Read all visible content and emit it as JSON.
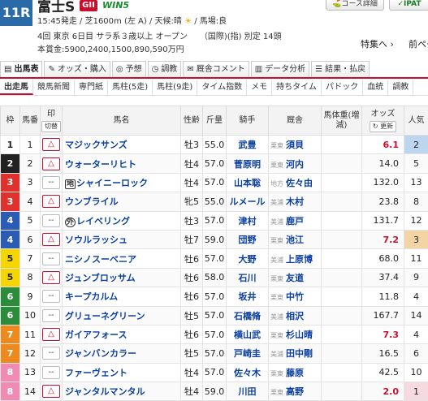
{
  "race": {
    "number": "11R",
    "name": "富士S",
    "grade": "GII",
    "win5": "WIN5",
    "post_time": "15:45発走",
    "distance": "芝1600m (左 A)",
    "weather_label": "天候:晴",
    "weather_icon": "sun-icon",
    "track_condition": "馬場:良",
    "meeting_line": "4回 東京 6日目 サラ系３歳以上 オープン　　（国際)(指) 別定 14頭",
    "prize_line": "本賞金:5900,2400,1500,890,590万円"
  },
  "header_buttons": {
    "course": "コース詳細",
    "ipat": "IPAT",
    "special": "特集へ",
    "next": "前ページ"
  },
  "tabs": [
    {
      "label": "出馬表",
      "icon": "table-icon"
    },
    {
      "label": "オッズ・購入",
      "icon": "odds-icon"
    },
    {
      "label": "予想",
      "icon": "target-icon"
    },
    {
      "label": "調教",
      "icon": "clock-icon"
    },
    {
      "label": "厩舎コメント",
      "icon": "comment-icon"
    },
    {
      "label": "データ分析",
      "icon": "chart-icon"
    },
    {
      "label": "結果・払戻",
      "icon": "result-icon"
    }
  ],
  "subtabs": [
    "出走馬",
    "競馬新聞",
    "専門紙",
    "馬柱(5走)",
    "馬柱(9走)",
    "タイム指数",
    "メモ",
    "持ちタイム",
    "パドック",
    "血統",
    "調教"
  ],
  "columns": {
    "waku": "枠",
    "umaban": "馬番",
    "mark": "印",
    "mark_sub": "切替",
    "horse": "馬名",
    "sex_age": "性齢",
    "weight": "斤量",
    "jockey": "騎手",
    "trainer": "厩舎",
    "body_weight": "馬体重(増減)",
    "odds": "オッズ",
    "odds_update": "更新",
    "popularity": "人気"
  },
  "rows": [
    {
      "waku": "1",
      "num": "1",
      "mark": "△",
      "name": "マジックサンズ",
      "prefix": "",
      "sex_age": "牡3",
      "weight": "55.0",
      "jockey": "武豊",
      "area": "栗東",
      "trainer": "須貝",
      "odds": "6.1",
      "hot": true,
      "pop": "2"
    },
    {
      "waku": "2",
      "num": "2",
      "mark": "△",
      "name": "ウォーターリヒト",
      "prefix": "",
      "sex_age": "牡4",
      "weight": "57.0",
      "jockey": "菅原明",
      "area": "栗東",
      "trainer": "河内",
      "odds": "14.0",
      "hot": false,
      "pop": "5"
    },
    {
      "waku": "3",
      "num": "3",
      "mark": "--",
      "name": "シャイニーロック",
      "prefix": "地",
      "sex_age": "牡4",
      "weight": "57.0",
      "jockey": "山本聡",
      "area": "地方",
      "trainer": "佐々由",
      "odds": "132.0",
      "hot": false,
      "pop": "13"
    },
    {
      "waku": "3",
      "num": "4",
      "mark": "△",
      "name": "ウンブライル",
      "prefix": "",
      "sex_age": "牝5",
      "weight": "55.0",
      "jockey": "ルメール",
      "area": "美浦",
      "trainer": "木村",
      "odds": "23.8",
      "hot": false,
      "pop": "8"
    },
    {
      "waku": "4",
      "num": "5",
      "mark": "--",
      "name": "レイベリング",
      "prefix": "外",
      "sex_age": "牡3",
      "weight": "57.0",
      "jockey": "津村",
      "area": "美浦",
      "trainer": "鹿戸",
      "odds": "131.7",
      "hot": false,
      "pop": "12"
    },
    {
      "waku": "4",
      "num": "6",
      "mark": "△",
      "name": "ソウルラッシュ",
      "prefix": "",
      "sex_age": "牡7",
      "weight": "59.0",
      "jockey": "団野",
      "area": "栗東",
      "trainer": "池江",
      "odds": "7.2",
      "hot": true,
      "pop": "3"
    },
    {
      "waku": "5",
      "num": "7",
      "mark": "--",
      "name": "ニシノスーベニア",
      "prefix": "",
      "sex_age": "牡6",
      "weight": "57.0",
      "jockey": "大野",
      "area": "美浦",
      "trainer": "上原博",
      "odds": "68.0",
      "hot": false,
      "pop": "11"
    },
    {
      "waku": "5",
      "num": "8",
      "mark": "△",
      "name": "ジュンブロッサム",
      "prefix": "",
      "sex_age": "牡6",
      "weight": "58.0",
      "jockey": "石川",
      "area": "栗東",
      "trainer": "友道",
      "odds": "37.4",
      "hot": false,
      "pop": "9"
    },
    {
      "waku": "6",
      "num": "9",
      "mark": "--",
      "name": "キープカルム",
      "prefix": "",
      "sex_age": "牡6",
      "weight": "57.0",
      "jockey": "坂井",
      "area": "栗東",
      "trainer": "中竹",
      "odds": "11.8",
      "hot": false,
      "pop": "4"
    },
    {
      "waku": "6",
      "num": "10",
      "mark": "--",
      "name": "グリューネグリーン",
      "prefix": "",
      "sex_age": "牡5",
      "weight": "57.0",
      "jockey": "石橋脩",
      "area": "美浦",
      "trainer": "相沢",
      "odds": "167.7",
      "hot": false,
      "pop": "14"
    },
    {
      "waku": "7",
      "num": "11",
      "mark": "△",
      "name": "ガイアフォース",
      "prefix": "",
      "sex_age": "牡6",
      "weight": "57.0",
      "jockey": "横山武",
      "area": "栗東",
      "trainer": "杉山晴",
      "odds": "7.3",
      "hot": true,
      "pop": "4"
    },
    {
      "waku": "7",
      "num": "12",
      "mark": "--",
      "name": "ジャンバンカラー",
      "prefix": "",
      "sex_age": "牡5",
      "weight": "57.0",
      "jockey": "戸崎圭",
      "area": "美浦",
      "trainer": "田中剛",
      "odds": "16.5",
      "hot": false,
      "pop": "6"
    },
    {
      "waku": "8",
      "num": "13",
      "mark": "--",
      "name": "ファーヴェント",
      "prefix": "",
      "sex_age": "牡4",
      "weight": "57.0",
      "jockey": "佐々木",
      "area": "栗東",
      "trainer": "藤原",
      "odds": "42.5",
      "hot": false,
      "pop": "10"
    },
    {
      "waku": "8",
      "num": "14",
      "mark": "△",
      "name": "ジャンタルマンタル",
      "prefix": "",
      "sex_age": "牡4",
      "weight": "59.0",
      "jockey": "川田",
      "area": "栗東",
      "trainer": "高野",
      "odds": "2.0",
      "hot": true,
      "pop": "1"
    }
  ]
}
